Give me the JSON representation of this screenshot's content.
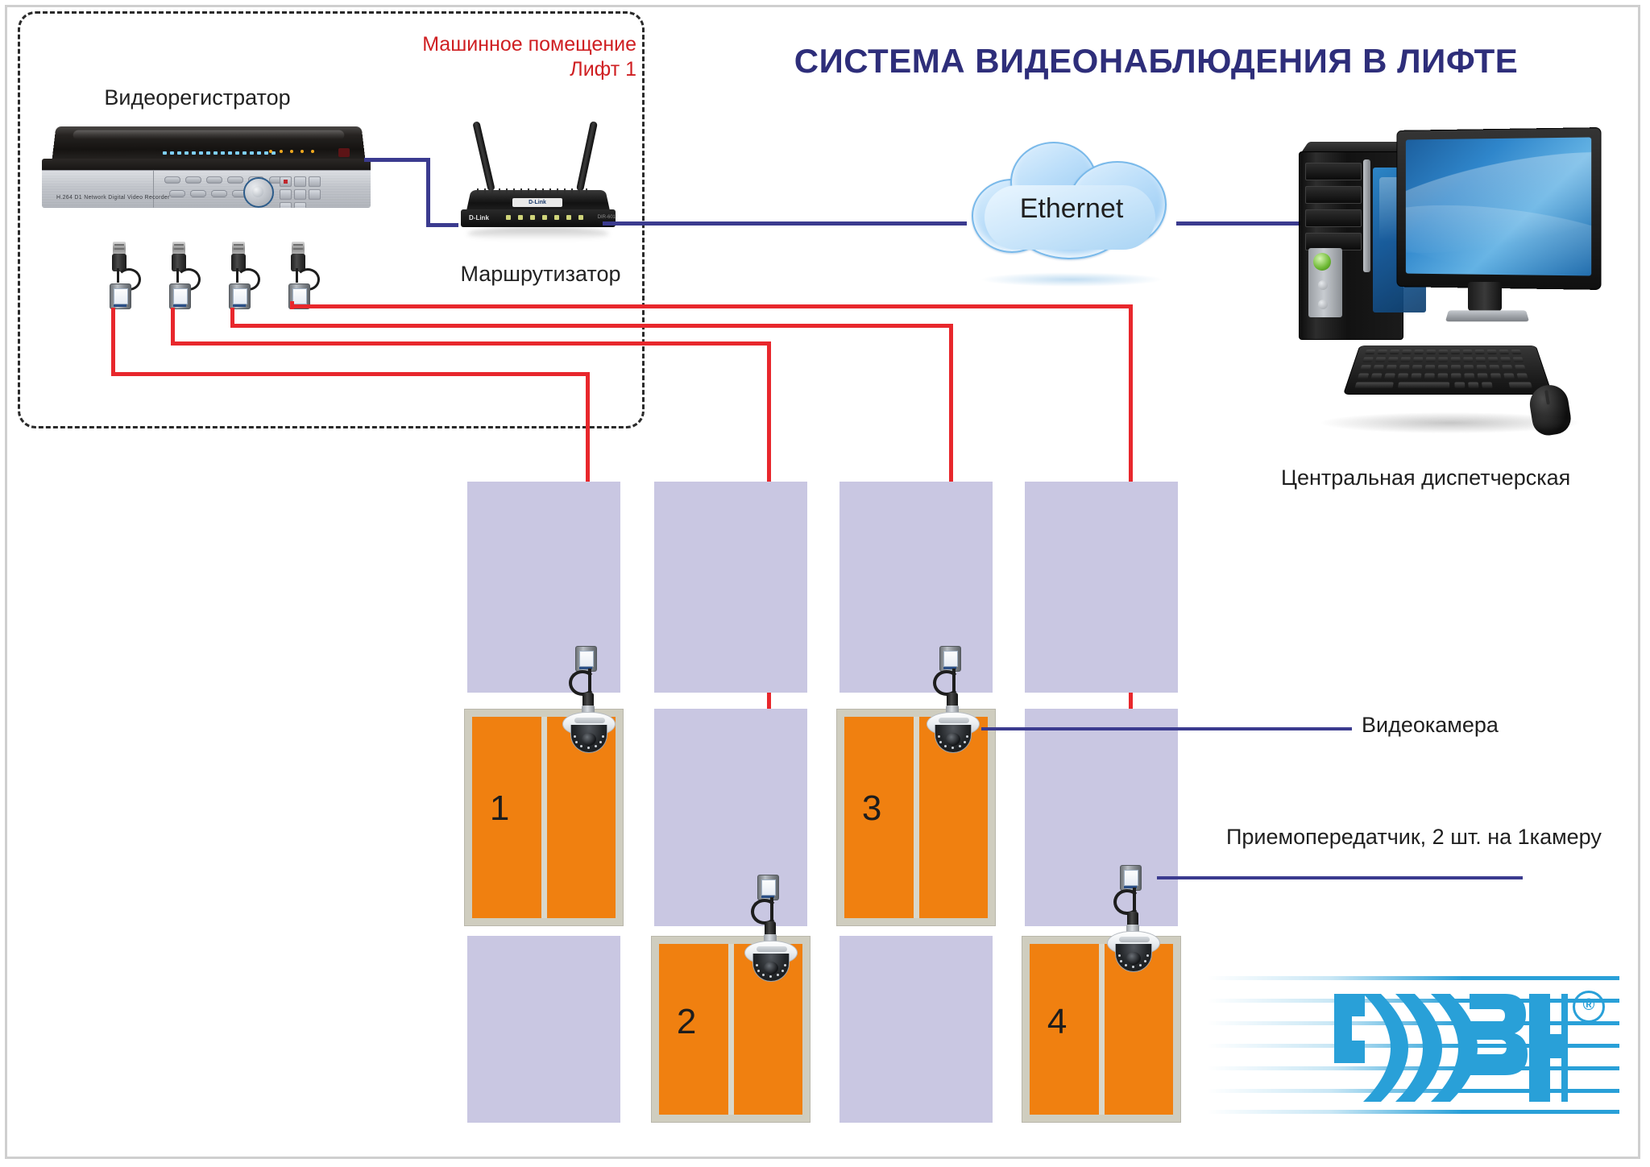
{
  "title": "СИСТЕМА ВИДЕОНАБЛЮДЕНИЯ В ЛИФТЕ",
  "machine_room": {
    "label_line1": "Машинное помещение",
    "label_line2": "Лифт 1",
    "label_color": "#cf1f22"
  },
  "devices": {
    "dvr_label": "Видеорегистратор",
    "dvr_model_text": "H.264 D1   Network Digital Video Recorder",
    "router_label": "Маршрутизатор",
    "router_brand": "D-Link",
    "router_logo": "D-Link",
    "router_model": "DIR-601",
    "cloud_label": "Ethernet",
    "workstation_label": "Центральная диспетчерская"
  },
  "legend": [
    {
      "label": "Видеокамера",
      "name": "camera-callout"
    },
    {
      "label": "Приемопередатчик, 2 шт. на 1камеру",
      "name": "transceiver-callout"
    }
  ],
  "elevators": [
    {
      "number": "1",
      "column": 1,
      "row": 2
    },
    {
      "number": "2",
      "column": 2,
      "row": 3
    },
    {
      "number": "3",
      "column": 3,
      "row": 2
    },
    {
      "number": "4",
      "column": 4,
      "row": 3
    }
  ],
  "logo": {
    "registered_mark": "®"
  },
  "colors": {
    "title": "#2e2e7a",
    "machine_room_text": "#cf1f22",
    "coax_cable": "#e8272c",
    "network_cable": "#3b3b8f",
    "shaft_fill": "#c9c7e2",
    "cabin_fill": "#f08010",
    "cabin_frame": "#cfcdbf",
    "logo_blue": "#29a0d8",
    "cloud_blue": "#8fc6f2"
  }
}
